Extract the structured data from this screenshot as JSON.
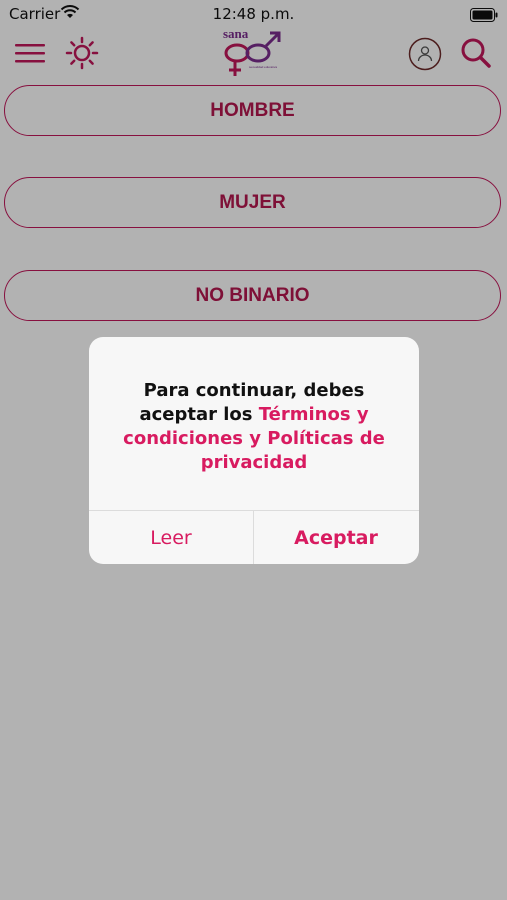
{
  "status_bar": {
    "carrier": "Carrier",
    "time": "12:48 p.m."
  },
  "header": {
    "logo_text": "sana",
    "logo_tagline": "sexualidad educativa"
  },
  "gender_options": [
    {
      "label": "HOMBRE"
    },
    {
      "label": "MUJER"
    },
    {
      "label": "NO BINARIO"
    }
  ],
  "dialog": {
    "message_plain": "Para continuar, debes aceptar los ",
    "message_link": "Términos y condiciones y Políticas de privacidad",
    "read_label": "Leer",
    "accept_label": "Aceptar"
  },
  "colors": {
    "accent": "#d81b60",
    "button_text": "#b5174f",
    "logo_purple": "#7b2d8e",
    "overlay": "rgba(0,0,0,0.30)"
  },
  "icons": [
    "wifi-icon",
    "battery-icon",
    "menu-icon",
    "sun-icon",
    "user-icon",
    "search-icon"
  ]
}
